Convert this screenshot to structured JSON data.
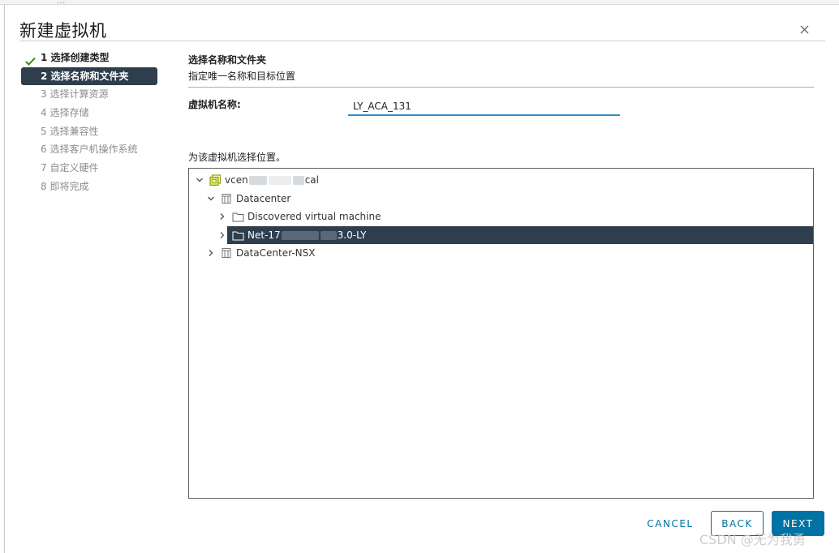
{
  "background": {
    "obscured_text": "..."
  },
  "dialog": {
    "title": "新建虚拟机",
    "close_icon": "close-icon"
  },
  "steps": [
    {
      "label": "1 选择创建类型",
      "state": "done"
    },
    {
      "label": "2 选择名称和文件夹",
      "state": "active"
    },
    {
      "label": "3 选择计算资源",
      "state": "pending"
    },
    {
      "label": "4 选择存储",
      "state": "pending"
    },
    {
      "label": "5 选择兼容性",
      "state": "pending"
    },
    {
      "label": "6 选择客户机操作系统",
      "state": "pending"
    },
    {
      "label": "7 自定义硬件",
      "state": "pending"
    },
    {
      "label": "8 即将完成",
      "state": "pending"
    }
  ],
  "content": {
    "title": "选择名称和文件夹",
    "subtitle": "指定唯一名称和目标位置",
    "vm_name_label": "虚拟机名称:",
    "vm_name_value": "LY_ACA_131",
    "location_label": "为该虚拟机选择位置。"
  },
  "tree": {
    "vcenter": {
      "prefix": "vcen",
      "suffix": "cal",
      "icon": "vcenter-icon",
      "expanded": true
    },
    "datacenter": {
      "label": "Datacenter",
      "icon": "datacenter-icon",
      "expanded": true
    },
    "discovered": {
      "label": "Discovered virtual machine",
      "icon": "folder-icon",
      "expanded": false
    },
    "net_folder": {
      "prefix": "Net-17",
      "suffix": "3.0-LY",
      "icon": "folder-icon",
      "selected": true
    },
    "datacenter_nsx": {
      "label": "DataCenter-NSX",
      "icon": "datacenter-icon",
      "expanded": false
    }
  },
  "buttons": {
    "cancel": "CANCEL",
    "back": "BACK",
    "next": "NEXT"
  },
  "watermark": "CSDN @无为我勇",
  "colors": {
    "accent": "#0072a3",
    "active_step": "#2e3e4d",
    "check": "#3c8500",
    "input_underline": "#2a8fc6"
  }
}
